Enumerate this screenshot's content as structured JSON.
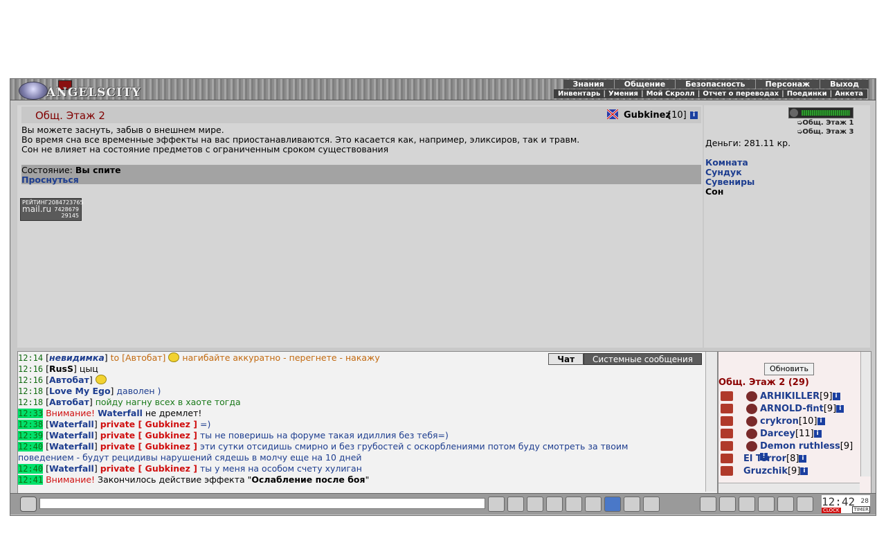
{
  "header": {
    "logo_text": "ANGELSCITY",
    "menu": [
      "Знания",
      "Общение",
      "Безопасность",
      "Персонаж",
      "Выход"
    ],
    "submenu": [
      "Инвентарь",
      "Умения",
      "Мой Скролл",
      "Отчет о переводах",
      "Поединки",
      "Анкета"
    ]
  },
  "room": {
    "title": "Общ. Этаж 2",
    "user_name": "Gubkinez",
    "user_level": "[10]",
    "description": [
      "Вы можете заснуть, забыв о внешнем мире.",
      "Во время сна все временные эффекты на вас приостанавливаются. Это касается как, например, эликсиров, так и травм.",
      "Сон не влияет на состояние предметов с ограниченным сроком существования"
    ],
    "state_label": "Состояние:",
    "state_value": "Вы спите",
    "wake_link": "Проснуться",
    "counter": {
      "label": "РЕЙТИНГ",
      "n1": "2084723765",
      "brand": "mail.ru",
      "n2": "7428679",
      "n3": "29145"
    }
  },
  "side": {
    "hp_fraction": 1.0,
    "nav": [
      "Общ. Этаж 1",
      "Общ. Этаж 3"
    ],
    "money": "Деньги: 281.11 кр.",
    "links": [
      "Комната",
      "Сундук",
      "Сувениры",
      "Сон"
    ]
  },
  "chat": {
    "tabs": [
      "Чат",
      "Системные сообщения"
    ],
    "lines": [
      {
        "time": "12:14",
        "highlight": false,
        "html": "[<b><i class='bl'>невидимка</i></b>] <span class='or'>to [Автобат]</span> <span class='sm'></span> <span class='or'>нагибайте аккуратно - перегнете - накажу</span>"
      },
      {
        "time": "12:16",
        "highlight": false,
        "html": "[<b>RusS</b>] цыц"
      },
      {
        "time": "12:16",
        "highlight": false,
        "html": "[<b class='bl'>Автобат</b>] <span class='sm'></span>"
      },
      {
        "time": "12:18",
        "highlight": false,
        "html": "[<b class='bl'>Love My Ego</b>] <span class='bl'>даволен )</span>"
      },
      {
        "time": "12:18",
        "highlight": false,
        "html": "[<b class='bl'>Автобат</b>] <span class='gr'>пойду нагну всех в хаоте тогда</span>"
      },
      {
        "time": "12:33",
        "highlight": true,
        "html": "<span class='wn'>Внимание!</span> <b class='bl'>Waterfall</b> не дремлет!"
      },
      {
        "time": "12:38",
        "highlight": true,
        "html": "[<b class='bl'>Waterfall</b>] <span class='pr'>private [ Gubkinez ]</span> <span class='bl'>=)</span>"
      },
      {
        "time": "12:39",
        "highlight": true,
        "html": "[<b class='bl'>Waterfall</b>] <span class='pr'>private [ Gubkinez ]</span> <span class='bl'>ты не поверишь на форуме такая идиллия без тебя=)</span>"
      },
      {
        "time": "12:40",
        "highlight": true,
        "html": "[<b class='bl'>Waterfall</b>] <span class='pr'>private [ Gubkinez ]</span> <span class='bl'>эти сутки отсидишь смирно и без грубостей с оскорблениями потом буду смотреть за твоим</span>"
      },
      {
        "time": "",
        "highlight": false,
        "html": "<span class='bl'>поведением - будут рецидивы нарушений сядешь в молчу еще на 10 дней</span>"
      },
      {
        "time": "12:40",
        "highlight": true,
        "html": "[<b class='bl'>Waterfall</b>] <span class='pr'>private [ Gubkinez ]</span> <span class='bl'>ты у меня на особом счету хулиган</span>"
      },
      {
        "time": "12:41",
        "highlight": true,
        "html": "<span class='wn'>Внимание!</span> Закончилось действие эффекта \"<b>Ослабление после боя</b>\""
      }
    ]
  },
  "users": {
    "refresh": "Обновить",
    "title": "Общ. Этаж 2 (29)",
    "list": [
      {
        "name": "ARHIKILLER",
        "level": "[9]",
        "clan": true
      },
      {
        "name": "ARNOLD-fint",
        "level": "[9]",
        "clan": true
      },
      {
        "name": "crykron",
        "level": "[10]",
        "clan": true
      },
      {
        "name": "Darcey",
        "level": "[11]",
        "clan": true
      },
      {
        "name": "Demon ruthless",
        "level": "[9]",
        "clan": true
      },
      {
        "name": "El Terror",
        "level": "[8]",
        "clan": false
      },
      {
        "name": "Gruzchik",
        "level": "[9]",
        "clan": false
      }
    ]
  },
  "clock": {
    "time": "12:42",
    "sec": "28",
    "clock_label": "CLOCK",
    "timer_label": "TIMER"
  }
}
